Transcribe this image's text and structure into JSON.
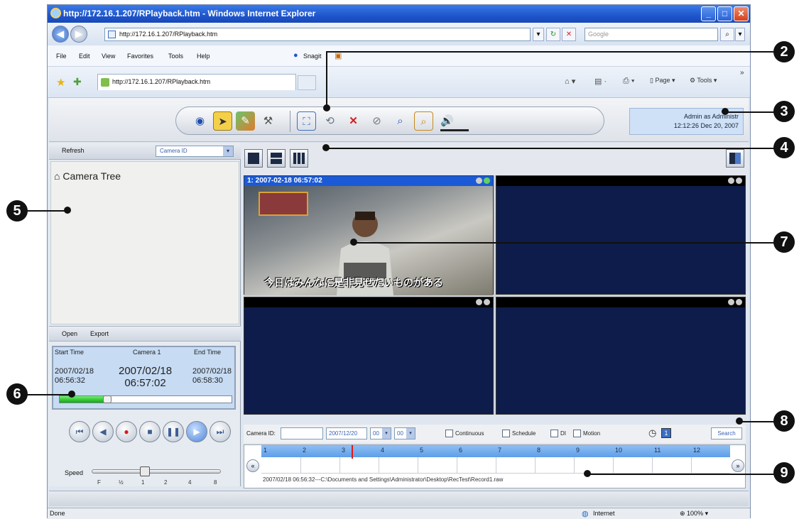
{
  "browser": {
    "title": "http://172.16.1.207/RPlayback.htm - Windows Internet Explorer",
    "address": "http://172.16.1.207/RPlayback.htm",
    "search_placeholder": "Google",
    "menu": [
      "File",
      "Edit",
      "View",
      "Favorites",
      "Tools",
      "Help"
    ],
    "snagit_label": "Snagit",
    "tab_title": "http://172.16.1.207/RPlayback.htm",
    "cmd_page": "Page",
    "cmd_tools": "Tools",
    "status_left": "Done",
    "status_zone": "Internet",
    "status_zoom": "100%"
  },
  "toolbar": {
    "icons": [
      "eye-icon",
      "arrow-tag-icon",
      "map-icon",
      "hammer-icon",
      "fullscreen-icon",
      "rotate-camera-icon",
      "delete-camera-icon",
      "disconnect-icon",
      "zoom-in-icon",
      "zoom-out-icon",
      "volume-icon"
    ]
  },
  "admin": {
    "line1": "Admin as Administr",
    "line2": "12:12:26 Dec 20, 2007"
  },
  "left": {
    "refresh_label": "Refresh",
    "camera_select": "Camera ID",
    "tree_title": "Camera Tree",
    "open_label": "Open",
    "export_label": "Export",
    "start_label": "Start Time",
    "camera_label": "Camera 1",
    "end_label": "End Time",
    "start_date": "2007/02/18",
    "start_time": "06:56:32",
    "current_date": "2007/02/18",
    "current_time": "06:57:02",
    "end_date": "2007/02/18",
    "end_time": "06:58:30",
    "progress": 0.27,
    "speed_label": "Speed",
    "speed_ticks": [
      "F",
      "½",
      "1",
      "2",
      "4",
      "8"
    ]
  },
  "video": {
    "cell1_caption": "1:  2007-02-18 06:57:02",
    "subtitle": "今日はみんなに是非見せたいものがある"
  },
  "search": {
    "camera_label": "Camera ID:",
    "date": "2007/12/20",
    "hour": "00",
    "minute": "00",
    "continuous": "Continuous",
    "schedule": "Schedule",
    "di": "DI",
    "motion": "Motion",
    "search_button": "Search"
  },
  "timeline": {
    "hours": [
      "1",
      "2",
      "3",
      "4",
      "5",
      "6",
      "7",
      "8",
      "9",
      "10",
      "11",
      "12"
    ],
    "record_path": "2007/02/18 06:56:32---C:\\Documents and Settings\\Administrator\\Desktop\\RecTest\\Record1.raw"
  },
  "callouts": [
    "2",
    "3",
    "4",
    "5",
    "6",
    "7",
    "8",
    "9"
  ],
  "colors": {
    "accent": "#1f56cc",
    "video_bg": "#0d1c4a",
    "progress": "#14a814"
  }
}
